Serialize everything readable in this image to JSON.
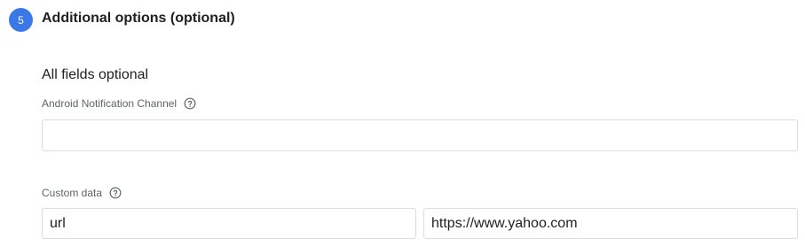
{
  "step": {
    "number": "5",
    "title": "Additional options (optional)"
  },
  "section": {
    "subtitle": "All fields optional"
  },
  "android_channel": {
    "label": "Android Notification Channel",
    "help_icon": "help-circle-icon",
    "value": ""
  },
  "custom_data": {
    "label": "Custom data",
    "help_icon": "help-circle-icon",
    "rows": [
      {
        "key": "url",
        "value": "https://www.yahoo.com"
      }
    ]
  },
  "colors": {
    "accent": "#3b78e7",
    "border": "#dadce0",
    "label": "#5f6368",
    "text": "#212121"
  }
}
